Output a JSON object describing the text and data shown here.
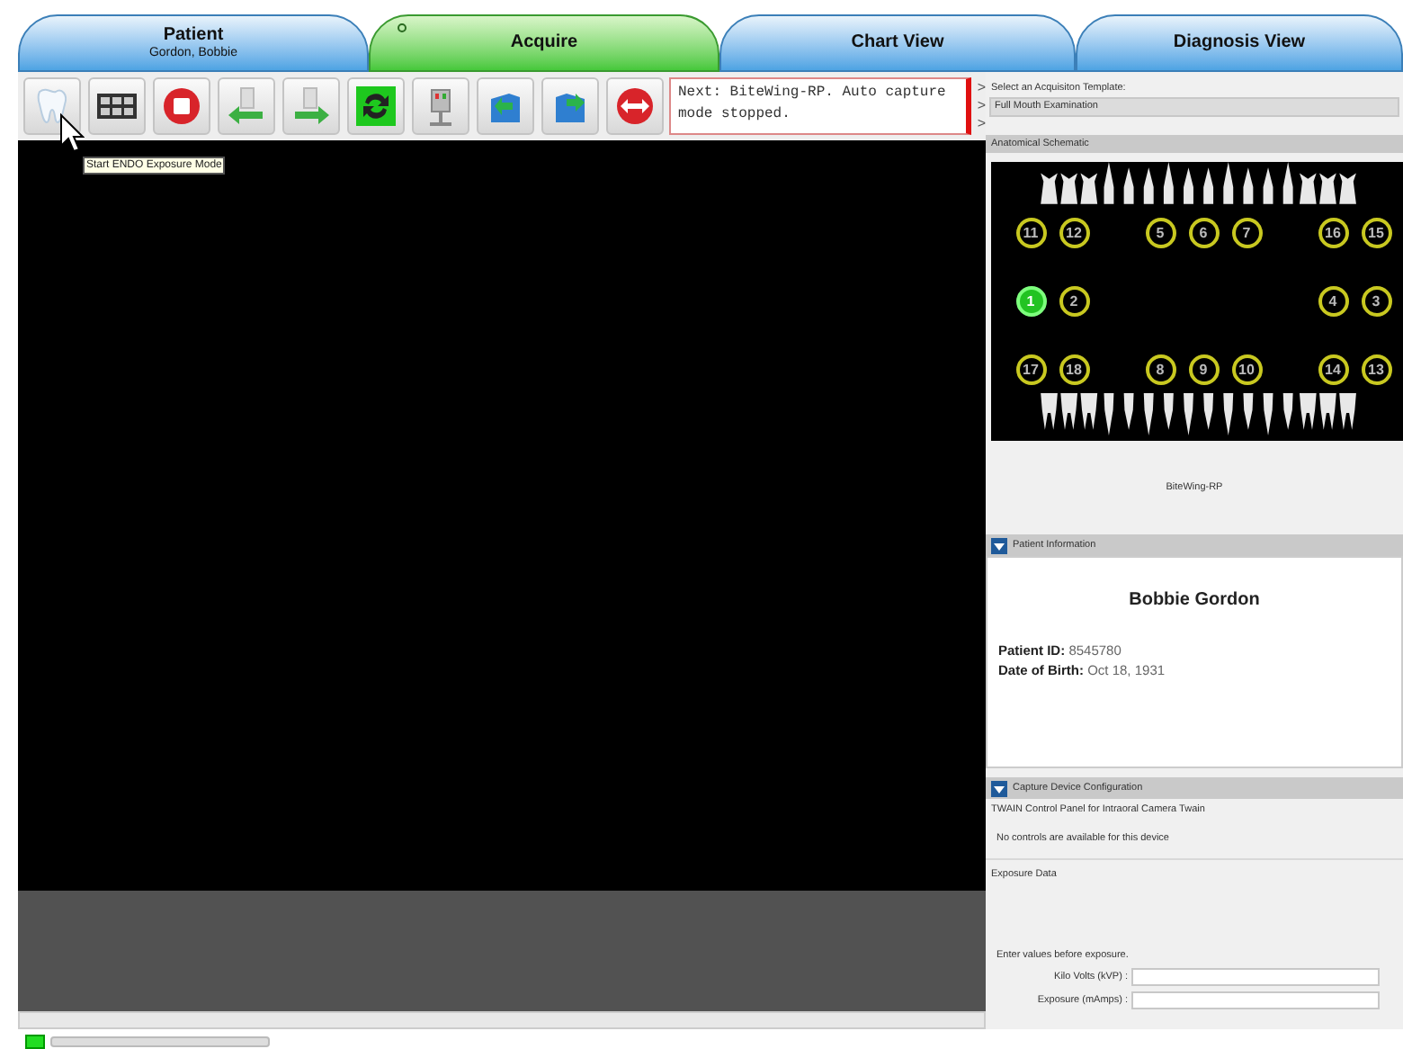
{
  "tabs": [
    {
      "label": "Patient",
      "subtitle": "Gordon, Bobbie",
      "selected": false
    },
    {
      "label": "Acquire",
      "selected": true
    },
    {
      "label": "Chart View",
      "selected": false
    },
    {
      "label": "Diagnosis View",
      "selected": false
    }
  ],
  "toolbar": [
    {
      "kind": "tooth"
    },
    {
      "kind": "grid"
    },
    {
      "kind": "stop"
    },
    {
      "kind": "prev"
    },
    {
      "kind": "next"
    },
    {
      "kind": "rotate"
    },
    {
      "kind": "sensor"
    },
    {
      "kind": "back"
    },
    {
      "kind": "forward"
    },
    {
      "kind": "swap"
    }
  ],
  "tooltip": "Start ENDO Exposure Mode",
  "message": "Next: BiteWing-RP.  Auto capture mode stopped.",
  "chevrons": [
    ">",
    ">",
    ">"
  ],
  "template": {
    "label": "Select an Acquisiton Template:",
    "value": "Full Mouth Examination"
  },
  "schematic": {
    "title": "Anatomical Schematic",
    "caption": "BiteWing-RP",
    "marker_rows": [
      [
        {
          "label": "11",
          "selected": false
        },
        {
          "label": "12",
          "selected": false
        },
        null,
        {
          "label": "5",
          "selected": false
        },
        {
          "label": "6",
          "selected": false
        },
        {
          "label": "7",
          "selected": false
        },
        null,
        {
          "label": "16",
          "selected": false
        },
        {
          "label": "15",
          "selected": false
        }
      ],
      [
        {
          "label": "1",
          "selected": true
        },
        {
          "label": "2",
          "selected": false
        },
        null,
        null,
        null,
        null,
        null,
        {
          "label": "4",
          "selected": false
        },
        {
          "label": "3",
          "selected": false
        }
      ],
      [
        {
          "label": "17",
          "selected": false
        },
        {
          "label": "18",
          "selected": false
        },
        null,
        {
          "label": "8",
          "selected": false
        },
        {
          "label": "9",
          "selected": false
        },
        {
          "label": "10",
          "selected": false
        },
        null,
        {
          "label": "14",
          "selected": false
        },
        {
          "label": "13",
          "selected": false
        }
      ]
    ]
  },
  "patient_info": {
    "title": "Patient Information",
    "expanded": true,
    "name": "Bobbie Gordon",
    "fields": [
      {
        "label": "Patient ID:",
        "value": "8545780"
      },
      {
        "label": "Date of Birth:",
        "value": "Oct 18, 1931"
      }
    ]
  },
  "capture_config": {
    "title": "Capture Device Configuration",
    "expanded": true,
    "twain_title": "TWAIN Control Panel for Intraoral Camera Twain",
    "twain_note": "No controls are available for this device",
    "exposure_title": "Exposure Data",
    "hint": "Enter values before exposure.",
    "fields": [
      {
        "label": "Kilo Volts (kVP) :"
      },
      {
        "label": "Exposure (mAmps) :"
      }
    ]
  }
}
